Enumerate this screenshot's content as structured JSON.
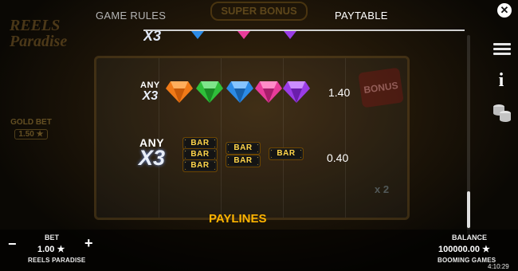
{
  "tabs": [
    {
      "label": "GAME RULES",
      "active": false
    },
    {
      "label": "PAYTABLE",
      "active": true
    }
  ],
  "close_icon": "close-icon",
  "background": {
    "logo_text": "REELS Paradise",
    "super_bonus": "SUPER BONUS",
    "gold_bet_label": "GOLD BET",
    "gold_bet_value": "1.50 ★",
    "bonus_symbol": "BONUS",
    "multiplier": "x 2"
  },
  "side_icons": [
    "menu-icon",
    "info-icon",
    "coins-icon"
  ],
  "info_glyph": "i",
  "paytable": {
    "rows": [
      {
        "any_label": "ANY",
        "multiplier_label": "X3",
        "symbols": [
          "orange-gem",
          "green-gem",
          "blue-gem",
          "pink-gem",
          "purple-gem"
        ],
        "payout": "1.40"
      },
      {
        "any_label": "ANY",
        "multiplier_label": "X3",
        "symbols": [
          "triple-bar",
          "double-bar",
          "single-bar"
        ],
        "bar_text": "BAR",
        "payout": "0.40"
      }
    ],
    "section_heading": "PAYLINES"
  },
  "colors": {
    "accent": "#ffb400",
    "gem_orange": "#f07a18",
    "gem_green": "#2fbf3a",
    "gem_blue": "#2c8be6",
    "gem_pink": "#e83c9a",
    "gem_purple": "#9a3ce6",
    "bar_gold": "#ffd54a"
  },
  "footer": {
    "bet_label": "BET",
    "bet_value": "1.00 ★",
    "minus": "−",
    "plus": "+",
    "game_name": "REELS PARADISE",
    "balance_label": "BALANCE",
    "balance_value": "100000.00 ★",
    "brand": "BOOMING GAMES",
    "clock": "4:10:29"
  }
}
